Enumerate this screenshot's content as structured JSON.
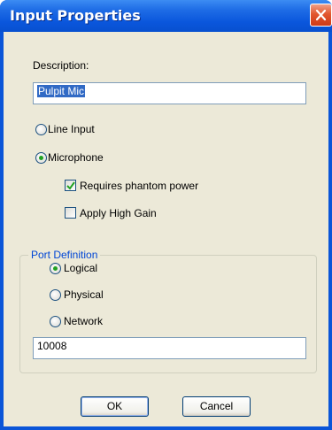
{
  "window": {
    "title": "Input Properties"
  },
  "description": {
    "label": "Description:",
    "value": "Pulpit Mic"
  },
  "input_type": {
    "options": [
      {
        "label": "Line Input",
        "selected": false
      },
      {
        "label": "Microphone",
        "selected": true
      }
    ]
  },
  "microphone_options": {
    "phantom_power": {
      "label": "Requires phantom power",
      "checked": true
    },
    "high_gain": {
      "label": "Apply High Gain",
      "checked": false
    }
  },
  "port_definition": {
    "title": "Port Definition",
    "options": [
      {
        "label": "Logical",
        "selected": true
      },
      {
        "label": "Physical",
        "selected": false
      },
      {
        "label": "Network",
        "selected": false
      }
    ],
    "value": "10008"
  },
  "buttons": {
    "ok": "OK",
    "cancel": "Cancel"
  },
  "colors": {
    "titlebar": "#0a55d8",
    "close_button": "#e2572f",
    "dialog_bg": "#ece9d8",
    "group_title": "#0046d5",
    "radio_dot": "#21a121"
  }
}
